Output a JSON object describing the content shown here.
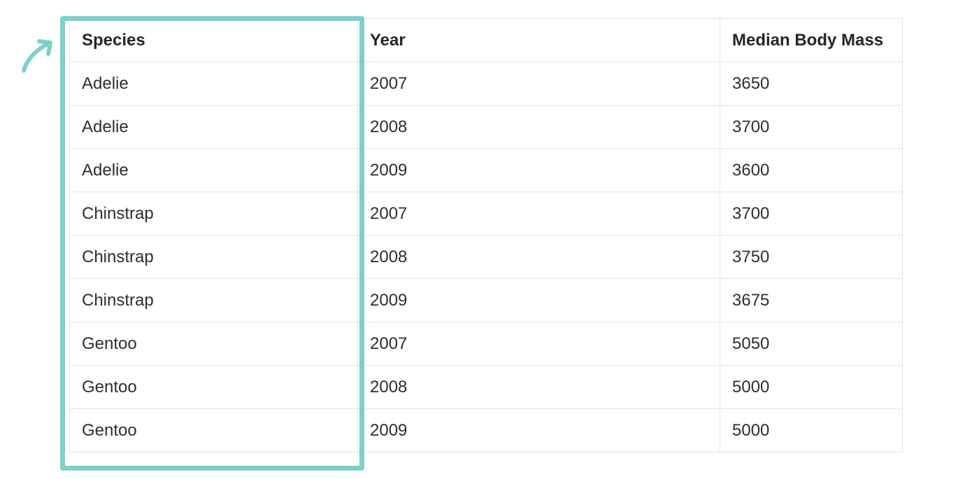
{
  "table": {
    "headers": [
      "Species",
      "Year",
      "Median Body Mass"
    ],
    "rows": [
      [
        "Adelie",
        "2007",
        "3650"
      ],
      [
        "Adelie",
        "2008",
        "3700"
      ],
      [
        "Adelie",
        "2009",
        "3600"
      ],
      [
        "Chinstrap",
        "2007",
        "3700"
      ],
      [
        "Chinstrap",
        "2008",
        "3750"
      ],
      [
        "Chinstrap",
        "2009",
        "3675"
      ],
      [
        "Gentoo",
        "2007",
        "5050"
      ],
      [
        "Gentoo",
        "2008",
        "5000"
      ],
      [
        "Gentoo",
        "2009",
        "5000"
      ]
    ]
  },
  "highlight": {
    "column": "Species",
    "color": "#7dd0c9"
  },
  "icons": {
    "arrow": "arrow-up-right-icon"
  }
}
